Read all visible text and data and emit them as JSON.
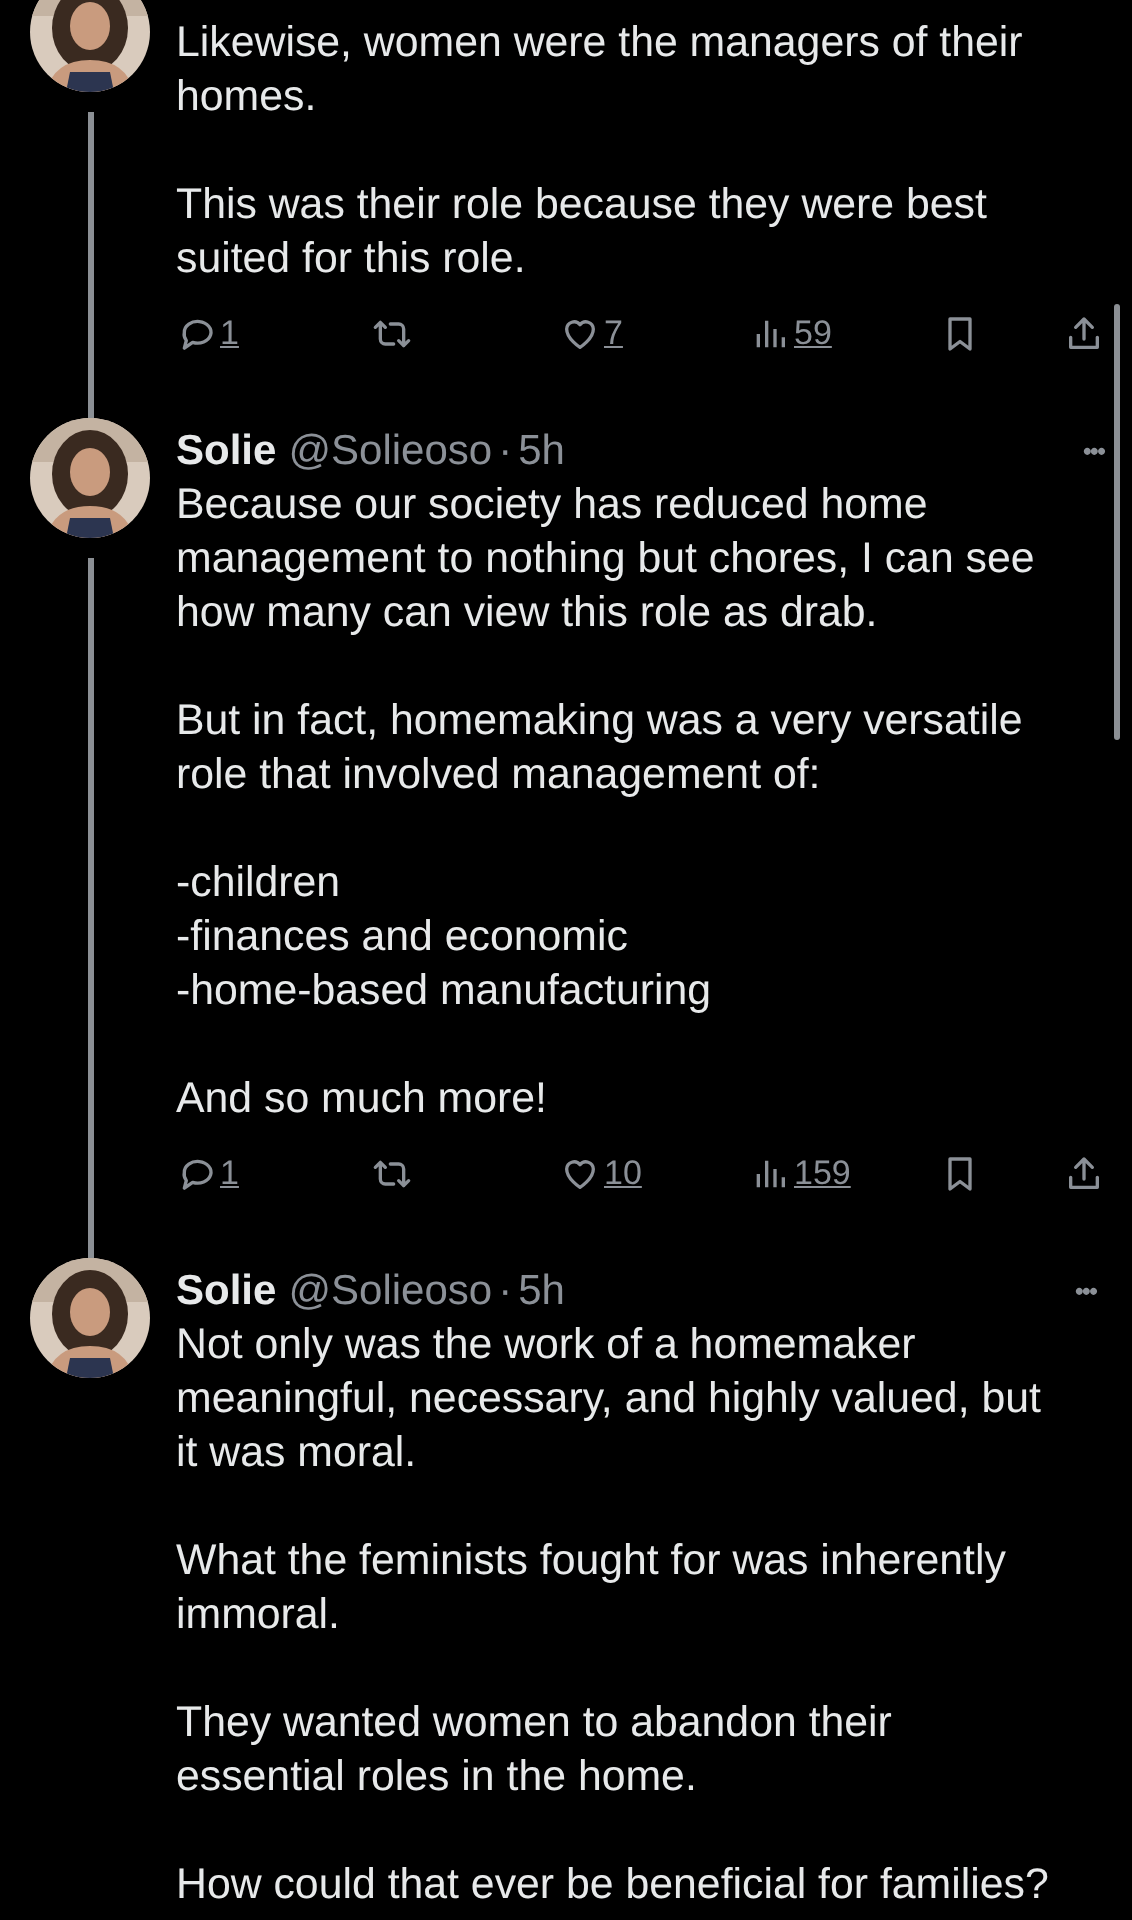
{
  "tweets": [
    {
      "thread_line": true,
      "paragraphs": [
        "Likewise, women were the managers of their homes.",
        "This was their role because they were best suited for this role."
      ],
      "actions": {
        "replies": "1",
        "likes": "7",
        "views": "59"
      }
    },
    {
      "thread_line": true,
      "header": {
        "name": "Solie",
        "handle": "@Solieoso",
        "dot": "·",
        "time": "5h",
        "more": "•••"
      },
      "paragraphs": [
        "Because our society has reduced home management to nothing but chores, I can see how many can view this role as drab.",
        "But in fact, homemaking was a very versatile role that involved management of:",
        "-children\n-finances and economic\n-home-based manufacturing",
        "And so much more!"
      ],
      "actions": {
        "replies": "1",
        "likes": "10",
        "views": "159"
      }
    },
    {
      "thread_line": false,
      "header": {
        "name": "Solie",
        "handle": "@Solieoso",
        "dot": "·",
        "time": "5h",
        "more": "•••"
      },
      "paragraphs": [
        "Not only was the work of a homemaker meaningful, necessary, and highly valued, but it was moral.",
        "What the feminists fought for was inherently immoral.",
        "They wanted women to abandon their essential roles in the home.",
        "How could that ever be beneficial for families?"
      ]
    }
  ]
}
